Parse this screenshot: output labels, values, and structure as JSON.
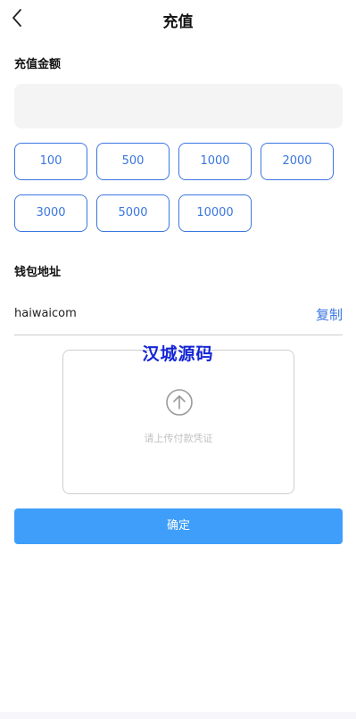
{
  "header": {
    "title": "充值",
    "back_icon": "chevron-left-icon"
  },
  "recharge": {
    "amount_label": "充值金额",
    "amount_value": "",
    "amount_placeholder": "",
    "amounts": [
      "100",
      "500",
      "1000",
      "2000",
      "3000",
      "5000",
      "10000"
    ]
  },
  "wallet": {
    "label": "钱包地址",
    "address": "haiwaicom",
    "copy_label": "复制"
  },
  "upload": {
    "icon": "arrow-up-circle-icon",
    "hint": "请上传付款凭证"
  },
  "watermark": "汉城源码",
  "confirm_label": "确定",
  "colors": {
    "accent": "#3a76e0",
    "button": "#3e9ef9",
    "input_bg": "#f4f4f4",
    "watermark": "#1426d6"
  }
}
